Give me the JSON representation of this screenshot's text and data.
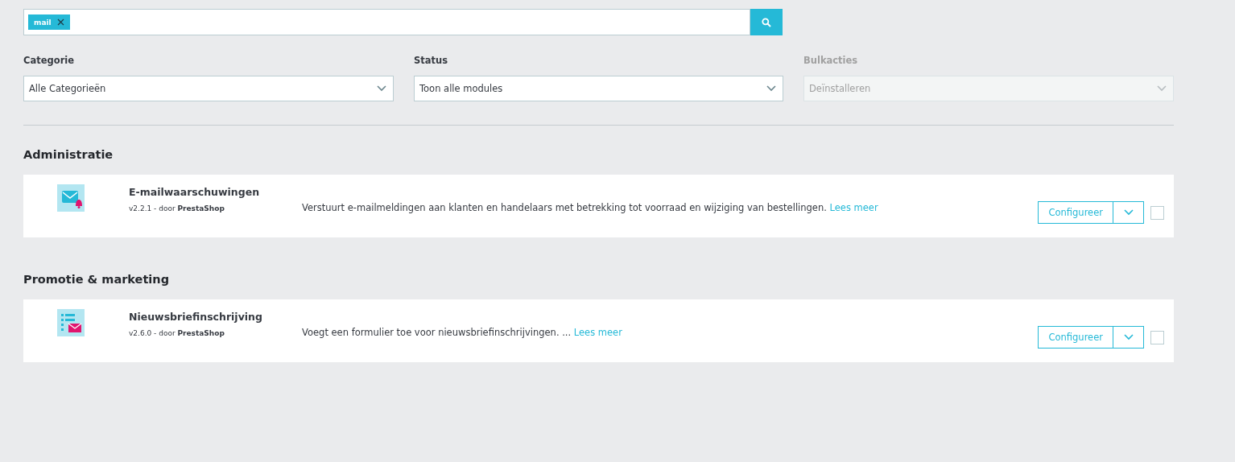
{
  "search": {
    "tags": [
      {
        "label": "mail"
      }
    ]
  },
  "filters": [
    {
      "label": "Categorie",
      "value": "Alle Categorieën",
      "disabled": false
    },
    {
      "label": "Status",
      "value": "Toon alle modules",
      "disabled": false
    },
    {
      "label": "Bulkacties",
      "value": "Deïnstalleren",
      "disabled": true
    }
  ],
  "sections": [
    {
      "title": "Administratie",
      "modules": [
        {
          "kind": "alert",
          "name": "E-mailwaarschuwingen",
          "meta": "v2.2.1 - door **PrestaShop**",
          "description": "Verstuurt e-mailmeldingen aan klanten en handelaars met betrekking tot voorraad en wijziging van bestellingen.",
          "link": "Lees meer",
          "button": "Configureer",
          "checked": false
        }
      ]
    },
    {
      "title": "Promotie & marketing",
      "modules": [
        {
          "kind": "newsletter",
          "name": "Nieuwsbriefinschrijving",
          "meta": "v2.6.0 - door **PrestaShop**",
          "description": "Voegt een formulier toe voor nieuwsbriefinschrijvingen. ...",
          "link": "Lees meer",
          "button": "Configureer",
          "checked": false
        }
      ]
    }
  ]
}
